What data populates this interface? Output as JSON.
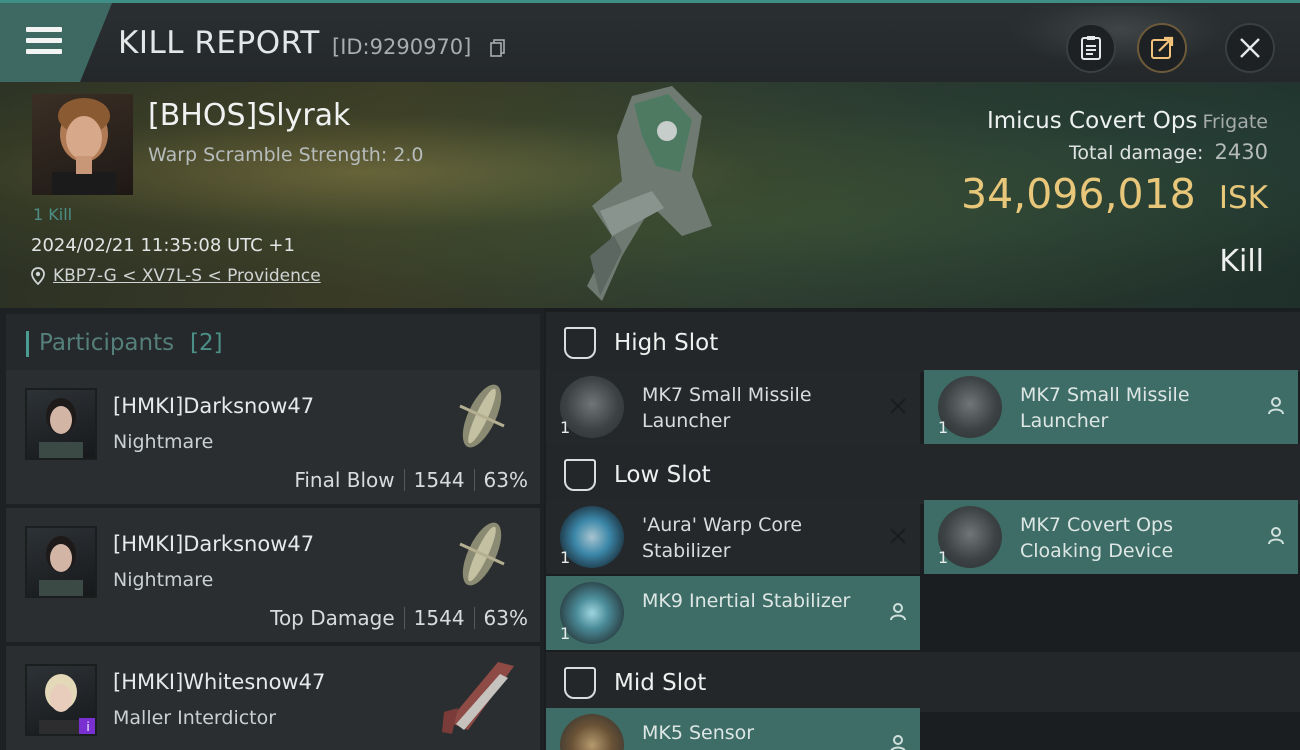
{
  "header": {
    "title": "KILL REPORT",
    "report_id": "[ID:9290970]"
  },
  "victim": {
    "name": "[BHOS]Slyrak",
    "warp_scramble": "Warp Scramble Strength: 2.0",
    "kill_count": "1 Kill",
    "timestamp": "2024/02/21 11:35:08 UTC +1",
    "location": "KBP7-G < XV7L-S < Providence",
    "ship_name": "Imicus Covert Ops",
    "ship_class": "Frigate",
    "total_damage_label": "Total damage:",
    "total_damage": "2430",
    "isk_value": "34,096,018",
    "isk_unit": "ISK",
    "report_type": "Kill"
  },
  "participants": {
    "title": "Participants",
    "count": "[2]",
    "items": [
      {
        "name": "[HMKI]Darksnow47",
        "ship": "Nightmare",
        "role": "Final Blow",
        "damage": "1544",
        "percent": "63%"
      },
      {
        "name": "[HMKI]Darksnow47",
        "ship": "Nightmare",
        "role": "Top Damage",
        "damage": "1544",
        "percent": "63%"
      },
      {
        "name": "[HMKI]Whitesnow47",
        "ship": "Maller Interdictor",
        "role": "",
        "damage": "",
        "percent": ""
      }
    ]
  },
  "fitting": {
    "high_slot": {
      "title": "High Slot",
      "modules": [
        {
          "name": "MK7 Small Missile Launcher",
          "qty": "1",
          "status": "destroyed"
        },
        {
          "name": "MK7 Small Missile Launcher",
          "qty": "1",
          "status": "dropped"
        }
      ]
    },
    "low_slot": {
      "title": "Low Slot",
      "modules": [
        {
          "name": "'Aura' Warp Core Stabilizer",
          "qty": "1",
          "status": "destroyed"
        },
        {
          "name": "MK7 Covert Ops Cloaking Device",
          "qty": "1",
          "status": "dropped"
        },
        {
          "name": "MK9 Inertial Stabilizer",
          "qty": "1",
          "status": "dropped"
        }
      ]
    },
    "mid_slot": {
      "title": "Mid Slot",
      "modules": [
        {
          "name": "MK5 Sensor",
          "qty": "1",
          "status": "dropped"
        }
      ]
    }
  },
  "colors": {
    "accent": "#3f8f86",
    "isk": "#e8c77a",
    "dropped_bg": "#3d6d66"
  },
  "icons": [
    "menu-icon",
    "copy-icon",
    "clipboard-icon",
    "export-icon",
    "close-icon",
    "location-pin-icon",
    "slot-icon",
    "destroyed-x-icon",
    "person-icon"
  ]
}
